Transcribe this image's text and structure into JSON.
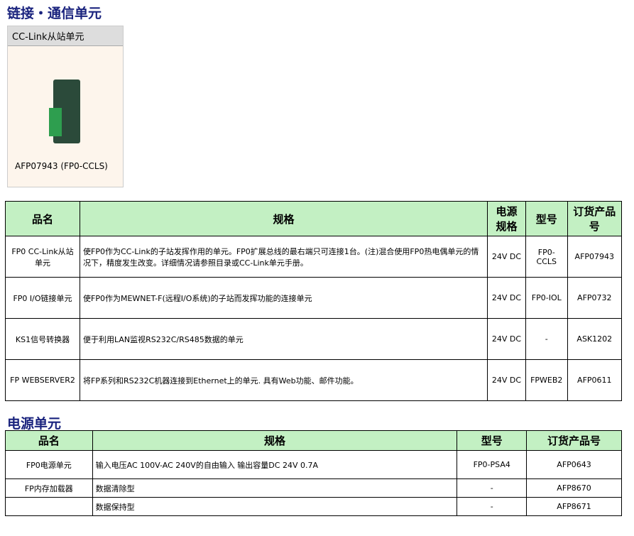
{
  "h1": "链接・通信单元",
  "h2": "电源单元",
  "card": {
    "title": "CC-Link从站单元",
    "cap": "AFP07943 (FP0-CCLS)"
  },
  "t1": {
    "head": [
      "品名",
      "规格",
      "电源规格",
      "型号",
      "订货产品号"
    ],
    "rows": [
      [
        "FP0 CC-Link从站单元",
        "使FP0作为CC-Link的子站发挥作用的单元。FP0扩展总线的最右端只可连接1台。(注)混合使用FP0热电偶单元的情况下，精度发生改变。详细情况请参照目录或CC-Link单元手册。",
        "24V DC",
        "FP0-CCLS",
        "AFP07943"
      ],
      [
        "FP0 I/O链接单元",
        "使FP0作为MEWNET-F(远程I/O系统)的子站而发挥功能的连接单元",
        "24V DC",
        "FP0-IOL",
        "AFP0732"
      ],
      [
        "KS1信号转换器",
        "便于利用LAN监视RS232C/RS485数据的单元",
        "24V DC",
        "-",
        "ASK1202"
      ],
      [
        "FP WEBSERVER2",
        "将FP系列和RS232C机器连接到Ethernet上的单元. 具有Web功能、邮件功能。",
        "24V DC",
        "FPWEB2",
        "AFP0611"
      ]
    ]
  },
  "t2": {
    "head": [
      "品名",
      "规格",
      "型号",
      "订货产品号"
    ],
    "rows": [
      [
        "FP0电源单元",
        "输入电压AC 100V-AC 240V的自由输入 输出容量DC 24V 0.7A",
        "FP0-PSA4",
        "AFP0643"
      ],
      [
        "FP内存加载器",
        "数据清除型",
        "-",
        "AFP8670"
      ],
      [
        "",
        "数据保持型",
        "-",
        "AFP8671"
      ]
    ]
  }
}
